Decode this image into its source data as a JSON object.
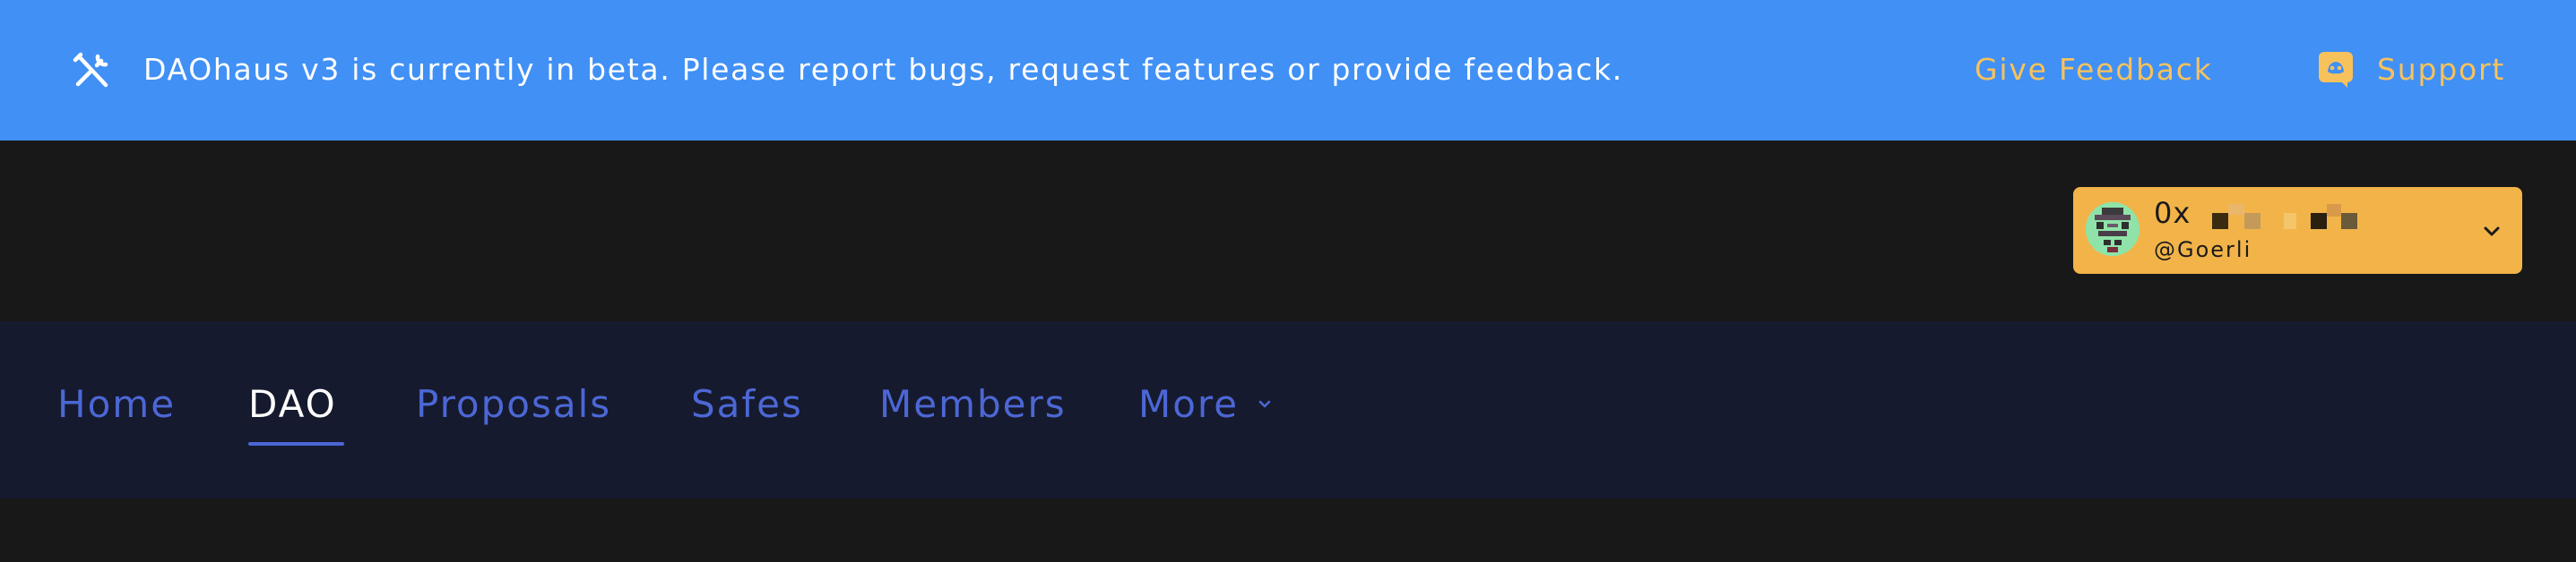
{
  "banner": {
    "message": "DAOhaus v3 is currently in beta. Please report bugs, request features or provide feedback.",
    "feedback_label": "Give Feedback",
    "support_label": "Support",
    "icons": {
      "tools": "tools-icon",
      "support": "discord-icon"
    },
    "colors": {
      "background": "#4190f5",
      "link": "#f7c25c",
      "text": "#ffffff"
    }
  },
  "wallet": {
    "address": "0x",
    "network": "@Goerli",
    "icons": {
      "avatar": "avatar",
      "dropdown": "chevron-down-icon"
    },
    "colors": {
      "background": "#f2b449"
    }
  },
  "nav": {
    "tabs": [
      {
        "label": "Home"
      },
      {
        "label": "DAO",
        "active": true
      },
      {
        "label": "Proposals"
      },
      {
        "label": "Safes"
      },
      {
        "label": "Members"
      },
      {
        "label": "More"
      }
    ],
    "colors": {
      "inactive": "#4c67d5",
      "active": "#ffffff",
      "background": "#161a2e"
    }
  },
  "theme": {
    "page_background": "#181818"
  }
}
